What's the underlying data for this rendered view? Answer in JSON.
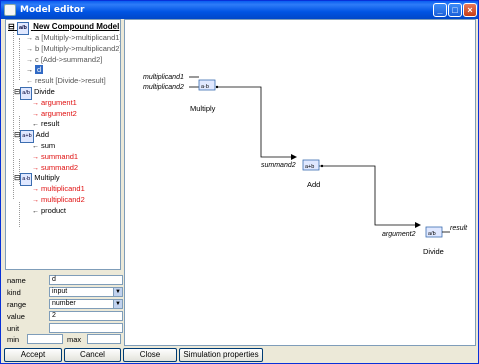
{
  "window": {
    "title": "Model editor"
  },
  "tree": {
    "root": "New Compound Model",
    "items": [
      {
        "label": "a [Multiply->multiplicand1]",
        "style": "gray",
        "arrow": "→"
      },
      {
        "label": "b [Multiply->multiplicand2]",
        "style": "gray",
        "arrow": "→"
      },
      {
        "label": "c [Add->summand2]",
        "style": "gray",
        "arrow": "→"
      },
      {
        "label": "d",
        "style": "selected",
        "arrow": "→"
      },
      {
        "label": "result [Divide->result]",
        "style": "gray",
        "arrow": "←"
      }
    ],
    "groups": [
      {
        "name": "Divide",
        "icon": "a/b",
        "children": [
          {
            "label": "argument1",
            "style": "red",
            "arrow": "→"
          },
          {
            "label": "argument2",
            "style": "red",
            "arrow": "→"
          },
          {
            "label": "result",
            "style": "normal",
            "arrow": "←"
          }
        ]
      },
      {
        "name": "Add",
        "icon": "a+b",
        "children": [
          {
            "label": "sum",
            "style": "normal",
            "arrow": "←"
          },
          {
            "label": "summand1",
            "style": "red",
            "arrow": "→"
          },
          {
            "label": "summand2",
            "style": "red",
            "arrow": "→"
          }
        ]
      },
      {
        "name": "Multiply",
        "icon": "a·b",
        "children": [
          {
            "label": "multiplicand1",
            "style": "red",
            "arrow": "→"
          },
          {
            "label": "multiplicand2",
            "style": "red",
            "arrow": "→"
          },
          {
            "label": "product",
            "style": "normal",
            "arrow": "←"
          }
        ]
      }
    ]
  },
  "properties": {
    "name_label": "name",
    "name_value": "d",
    "kind_label": "kind",
    "kind_value": "input",
    "range_label": "range",
    "range_value": "number",
    "value_label": "value",
    "value_value": "2",
    "unit_label": "unit",
    "unit_value": "",
    "min_label": "min",
    "min_value": "",
    "max_label": "max",
    "max_value": ""
  },
  "diagram": {
    "multiply": {
      "title": "Multiply",
      "icon": "a·b",
      "input1": "multiplicand1",
      "input2": "multiplicand2"
    },
    "add": {
      "title": "Add",
      "icon": "a+b",
      "input": "summand2"
    },
    "divide": {
      "title": "Divide",
      "icon": "a/b",
      "input": "argument2",
      "output": "result"
    }
  },
  "buttons": {
    "accept": "Accept",
    "cancel": "Cancel",
    "close": "Close",
    "simulation": "Simulation properties"
  }
}
